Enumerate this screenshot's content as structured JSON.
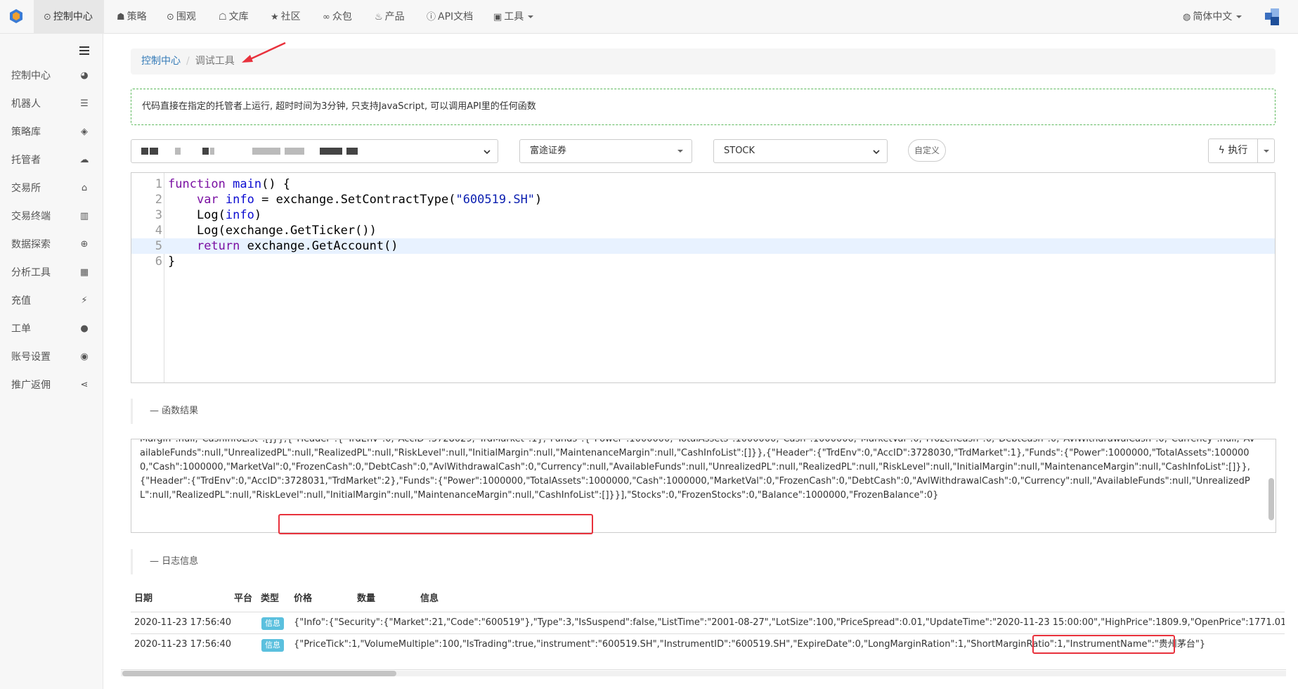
{
  "topnav": {
    "items": [
      {
        "label": "控制中心",
        "icon": "dashboard-icon"
      },
      {
        "label": "策略",
        "icon": "strategy-icon"
      },
      {
        "label": "围观",
        "icon": "play-circle-icon"
      },
      {
        "label": "文库",
        "icon": "graduation-cap-icon"
      },
      {
        "label": "社区",
        "icon": "star-icon"
      },
      {
        "label": "众包",
        "icon": "glasses-icon"
      },
      {
        "label": "产品",
        "icon": "fire-icon"
      },
      {
        "label": "API文档",
        "icon": "info-icon"
      },
      {
        "label": "工具",
        "icon": "briefcase-icon"
      }
    ],
    "language": "简体中文"
  },
  "sidebar": {
    "items": [
      {
        "label": "控制中心",
        "icon": "dashboard-icon"
      },
      {
        "label": "机器人",
        "icon": "list-icon"
      },
      {
        "label": "策略库",
        "icon": "cube-icon"
      },
      {
        "label": "托管者",
        "icon": "cloud-icon"
      },
      {
        "label": "交易所",
        "icon": "bank-icon"
      },
      {
        "label": "交易终端",
        "icon": "bar-chart-icon"
      },
      {
        "label": "数据探索",
        "icon": "search-plus-icon"
      },
      {
        "label": "分析工具",
        "icon": "calculator-icon"
      },
      {
        "label": "充值",
        "icon": "plug-icon"
      },
      {
        "label": "工单",
        "icon": "comment-icon"
      },
      {
        "label": "账号设置",
        "icon": "user-circle-icon"
      },
      {
        "label": "推广返佣",
        "icon": "share-icon"
      }
    ]
  },
  "breadcrumb": {
    "link": "控制中心",
    "separator": "/",
    "current": "调试工具"
  },
  "alert": {
    "text": "代码直接在指定的托管者上运行, 超时时间为3分钟, 只支持JavaScript, 可以调用API里的任何函数"
  },
  "controls": {
    "exchange": "富途证券",
    "contract": "STOCK",
    "custom_button": "自定义",
    "run_button": "执行"
  },
  "editor": {
    "lines": [
      "function main() {",
      "    var info = exchange.SetContractType(\"600519.SH\")",
      "    Log(info)",
      "    Log(exchange.GetTicker())",
      "    return exchange.GetAccount()",
      "}"
    ]
  },
  "result_section": {
    "title": "函数结果",
    "text": "Margin\":null,\"CashInfoList\":[]}},{\"Header\":{\"TrdEnv\":0,\"AccID\":3728029,\"TrdMarket\":1},\"Funds\":{\"Power\":1000000,\"TotalAssets\":1000000,\"Cash\":1000000,\"MarketVal\":0,\"FrozenCash\":0,\"DebtCash\":0,\"AvlWithdrawalCash\":0,\"Currency\":null,\"AvailableFunds\":null,\"UnrealizedPL\":null,\"RealizedPL\":null,\"RiskLevel\":null,\"InitialMargin\":null,\"MaintenanceMargin\":null,\"CashInfoList\":[]}},{\"Header\":{\"TrdEnv\":0,\"AccID\":3728030,\"TrdMarket\":1},\"Funds\":{\"Power\":1000000,\"TotalAssets\":1000000,\"Cash\":1000000,\"MarketVal\":0,\"FrozenCash\":0,\"DebtCash\":0,\"AvlWithdrawalCash\":0,\"Currency\":null,\"AvailableFunds\":null,\"UnrealizedPL\":null,\"RealizedPL\":null,\"RiskLevel\":null,\"InitialMargin\":null,\"MaintenanceMargin\":null,\"CashInfoList\":[]}},{\"Header\":{\"TrdEnv\":0,\"AccID\":3728031,\"TrdMarket\":2},\"Funds\":{\"Power\":1000000,\"TotalAssets\":1000000,\"Cash\":1000000,\"MarketVal\":0,\"FrozenCash\":0,\"DebtCash\":0,\"AvlWithdrawalCash\":0,\"Currency\":null,\"AvailableFunds\":null,\"UnrealizedPL\":null,\"RealizedPL\":null,\"RiskLevel\":null,\"InitialMargin\":null,\"MaintenanceMargin\":null,\"CashInfoList\":[]}}],\"Stocks\":0,\"FrozenStocks\":0,\"Balance\":1000000,\"FrozenBalance\":0}"
  },
  "log_section": {
    "title": "日志信息",
    "columns": [
      "日期",
      "平台",
      "类型",
      "价格",
      "数量",
      "信息"
    ],
    "rows": [
      {
        "date": "2020-11-23 17:56:40",
        "type": "信息",
        "info": "{\"Info\":{\"Security\":{\"Market\":21,\"Code\":\"600519\"},\"Type\":3,\"IsSuspend\":false,\"ListTime\":\"2001-08-27\",\"LotSize\":100,\"PriceSpread\":0.01,\"UpdateTime\":\"2020-11-23 15:00:00\",\"HighPrice\":1809.9,\"OpenPrice\":1771.01,\"LowPric"
      },
      {
        "date": "2020-11-23 17:56:40",
        "type": "信息",
        "info": "{\"PriceTick\":1,\"VolumeMultiple\":100,\"IsTrading\":true,\"instrument\":\"600519.SH\",\"InstrumentID\":\"600519.SH\",\"ExpireDate\":0,\"LongMarginRation\":1,\"ShortMarginRatio\":1,\"InstrumentName\":\"贵州茅台\"}"
      }
    ]
  },
  "colors": {
    "link": "#337ab7",
    "alert_border": "#5cb85c",
    "badge": "#5bc0de",
    "annotation": "#e8313c"
  }
}
